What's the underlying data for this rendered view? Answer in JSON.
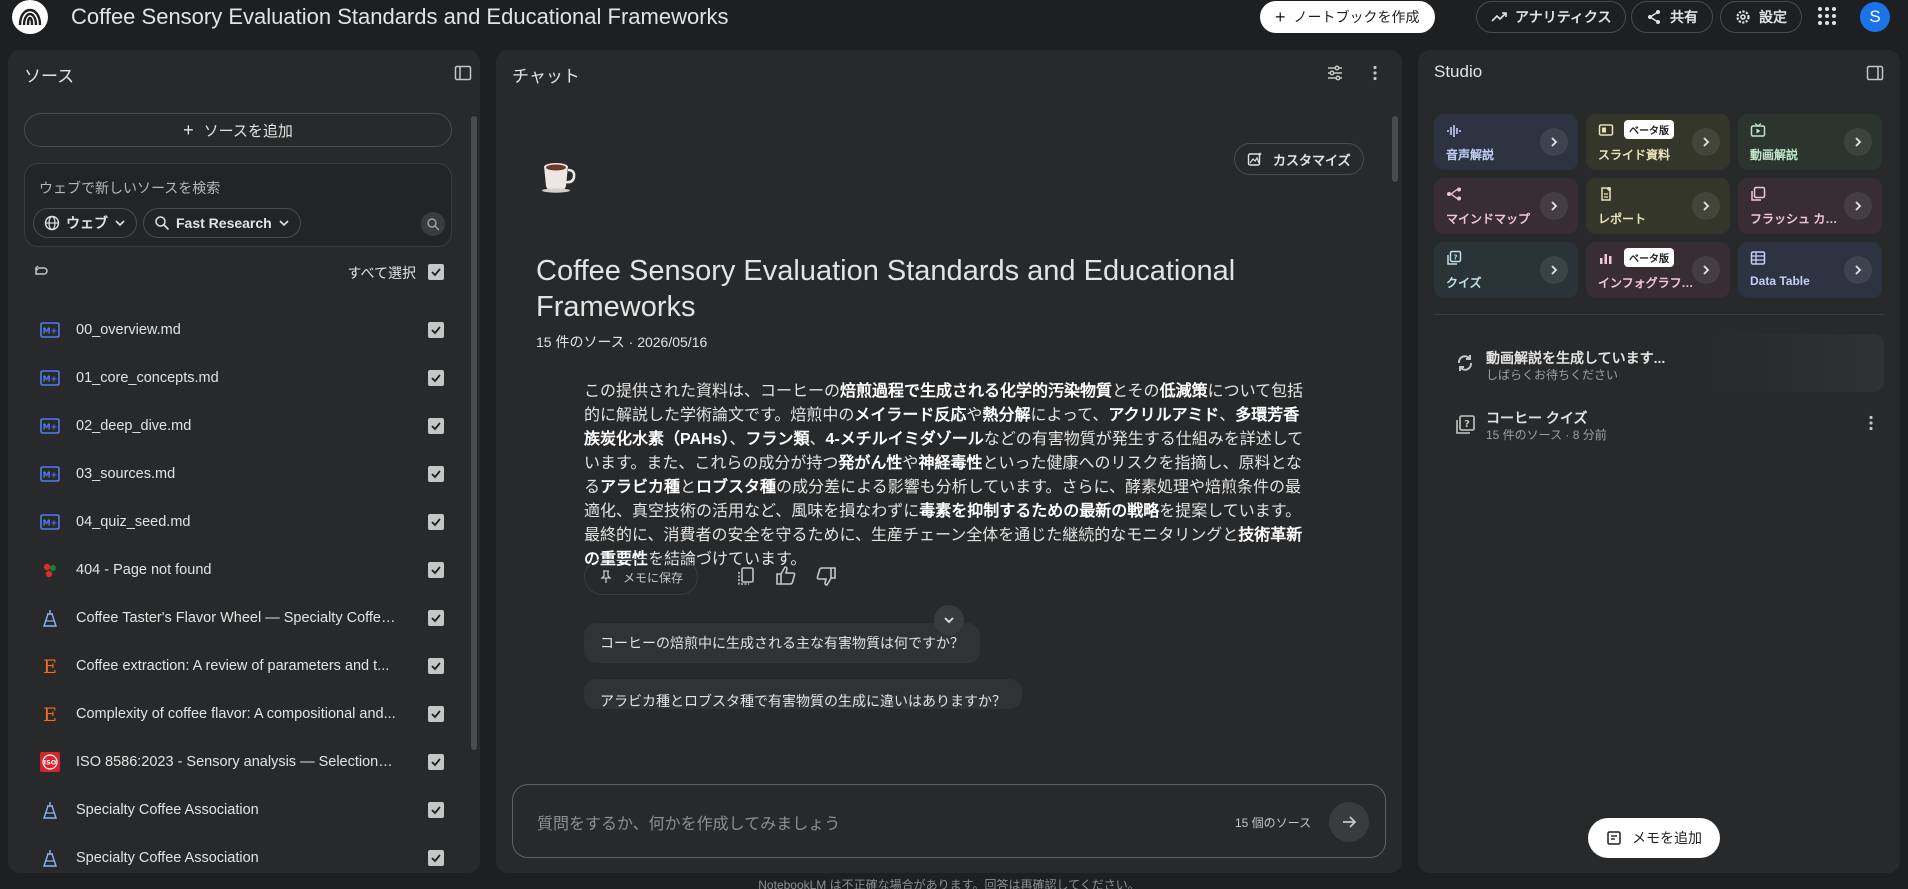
{
  "app": {
    "title": "Coffee Sensory Evaluation Standards and Educational Frameworks",
    "create_notebook": "ノートブックを作成",
    "analytics": "アナリティクス",
    "share": "共有",
    "settings": "設定",
    "avatar_letter": "S"
  },
  "sources": {
    "header": "ソース",
    "add_label": "ソースを追加",
    "search_placeholder": "ウェブで新しいソースを検索",
    "chip_web": "ウェブ",
    "chip_research": "Fast Research",
    "select_all": "すべて選択",
    "items": [
      {
        "title": "00_overview.md",
        "icon": "markdown-icon"
      },
      {
        "title": "01_core_concepts.md",
        "icon": "markdown-icon"
      },
      {
        "title": "02_deep_dive.md",
        "icon": "markdown-icon"
      },
      {
        "title": "03_sources.md",
        "icon": "markdown-icon"
      },
      {
        "title": "04_quiz_seed.md",
        "icon": "markdown-icon"
      },
      {
        "title": "404 - Page not found",
        "icon": "web-favicon-icon"
      },
      {
        "title": "Coffee Taster's Flavor Wheel — Specialty Coffee...",
        "icon": "sca-icon"
      },
      {
        "title": "Coffee extraction: A review of parameters and t...",
        "icon": "elsevier-icon"
      },
      {
        "title": "Complexity of coffee flavor: A compositional and...",
        "icon": "elsevier-icon"
      },
      {
        "title": "ISO 8586:2023 - Sensory analysis — Selection a...",
        "icon": "iso-icon"
      },
      {
        "title": "Specialty Coffee Association",
        "icon": "sca-icon"
      },
      {
        "title": "Specialty Coffee Association",
        "icon": "sca-icon"
      }
    ]
  },
  "chat": {
    "header": "チャット",
    "customize": "カスタマイズ",
    "nb_title": "Coffee Sensory Evaluation Standards and Educational Frameworks",
    "meta": "15 件のソース · 2026/05/16",
    "summary": [
      {
        "t": "この提供された資料は、コーヒーの",
        "b": false
      },
      {
        "t": "焙煎過程で生成される化学的汚染物質",
        "b": true
      },
      {
        "t": "とその",
        "b": false
      },
      {
        "t": "低減策",
        "b": true
      },
      {
        "t": "について包括的に解説した学術論文です。焙煎中の",
        "b": false
      },
      {
        "t": "メイラード反応",
        "b": true
      },
      {
        "t": "や",
        "b": false
      },
      {
        "t": "熱分解",
        "b": true
      },
      {
        "t": "によって、",
        "b": false
      },
      {
        "t": "アクリルアミド",
        "b": true
      },
      {
        "t": "、",
        "b": false
      },
      {
        "t": "多環芳香族炭化水素（PAHs）",
        "b": true
      },
      {
        "t": "、",
        "b": false
      },
      {
        "t": "フラン類",
        "b": true
      },
      {
        "t": "、",
        "b": false
      },
      {
        "t": "4-メチルイミダゾール",
        "b": true
      },
      {
        "t": "などの有害物質が発生する仕組みを詳述しています。また、これらの成分が持つ",
        "b": false
      },
      {
        "t": "発がん性",
        "b": true
      },
      {
        "t": "や",
        "b": false
      },
      {
        "t": "神経毒性",
        "b": true
      },
      {
        "t": "といった健康へのリスクを指摘し、原料となる",
        "b": false
      },
      {
        "t": "アラビカ種",
        "b": true
      },
      {
        "t": "と",
        "b": false
      },
      {
        "t": "ロブスタ種",
        "b": true
      },
      {
        "t": "の成分差による影響も分析しています。さらに、酵素処理や焙煎条件の最適化、真空技術の活用など、風味を損なわずに",
        "b": false
      },
      {
        "t": "毒素を抑制するための最新の戦略",
        "b": true
      },
      {
        "t": "を提案しています。最終的に、消費者の安全を守るために、生産チェーン全体を通じた継続的なモニタリングと",
        "b": false
      },
      {
        "t": "技術革新の重要性",
        "b": true
      },
      {
        "t": "を結論づけています。",
        "b": false
      }
    ],
    "save_memo": "メモに保存",
    "suggestions": [
      "コーヒーの焙煎中に生成される主な有害物質は何ですか？",
      "アラビカ種とロブスタ種で有害物質の生成に違いはありますか？"
    ],
    "input_placeholder": "質問をするか、何かを作成してみましょう",
    "source_count": "15 個のソース",
    "footer": "NotebookLM は不正確な場合があります。回答は再確認してください。"
  },
  "studio": {
    "header": "Studio",
    "beta": "ベータ版",
    "tiles": [
      {
        "label": "音声解説",
        "icon": "audio-icon",
        "bg": "#2e3342",
        "fg": "#c3d0f5",
        "beta": false
      },
      {
        "label": "スライド資料",
        "icon": "slides-icon",
        "bg": "#35362a",
        "fg": "#e6e4b8",
        "beta": true
      },
      {
        "label": "動画解説",
        "icon": "video-icon",
        "bg": "#2b342e",
        "fg": "#c1e6c9",
        "beta": false
      },
      {
        "label": "マインドマップ",
        "icon": "mindmap-icon",
        "bg": "#372d33",
        "fg": "#f0c7d8",
        "beta": false
      },
      {
        "label": "レポート",
        "icon": "report-icon",
        "bg": "#35362a",
        "fg": "#e6e4b8",
        "beta": false
      },
      {
        "label": "フラッシュ カード",
        "icon": "flashcard-icon",
        "bg": "#372d33",
        "fg": "#f0c7d8",
        "beta": false
      },
      {
        "label": "クイズ",
        "icon": "quiz-icon",
        "bg": "#2a3336",
        "fg": "#bfe0eb",
        "beta": false
      },
      {
        "label": "インフォグラフィック",
        "icon": "infographic-icon",
        "bg": "#372d33",
        "fg": "#f0c7d8",
        "beta": true
      },
      {
        "label": "Data Table",
        "icon": "table-icon",
        "bg": "#2e3342",
        "fg": "#c3d0f5",
        "beta": false
      }
    ],
    "generating_title": "動画解説を生成しています...",
    "generating_sub": "しばらくお待ちください",
    "quiz_title": "コーヒー クイズ",
    "quiz_sub": "15 件のソース · 8 分前",
    "add_memo": "メモを追加"
  }
}
